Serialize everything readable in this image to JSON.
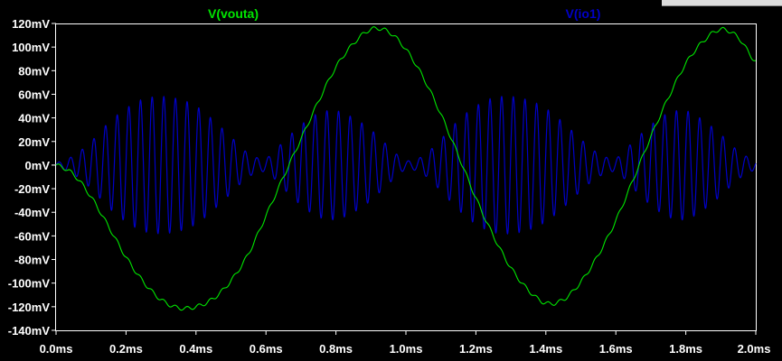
{
  "chart_data": {
    "type": "line",
    "title": "",
    "xlabel": "",
    "ylabel": "",
    "xlim": [
      0,
      2.0
    ],
    "ylim": [
      -140,
      120
    ],
    "x_unit": "ms",
    "y_unit": "mV",
    "grid": false,
    "legend_position": "top",
    "x_ticks": [
      "0.0ms",
      "0.2ms",
      "0.4ms",
      "0.6ms",
      "0.8ms",
      "1.0ms",
      "1.2ms",
      "1.4ms",
      "1.6ms",
      "1.8ms",
      "2.0ms"
    ],
    "y_ticks": [
      "120mV",
      "100mV",
      "80mV",
      "60mV",
      "40mV",
      "20mV",
      "0mV",
      "-20mV",
      "-40mV",
      "-60mV",
      "-80mV",
      "-100mV",
      "-120mV",
      "-140mV"
    ],
    "series": [
      {
        "name": "V(vouta)",
        "color": "#00e600",
        "x_ms": [
          0.0,
          0.05,
          0.1,
          0.15,
          0.2,
          0.25,
          0.3,
          0.35,
          0.4,
          0.45,
          0.5,
          0.55,
          0.6,
          0.65,
          0.7,
          0.75,
          0.8,
          0.85,
          0.9,
          0.95,
          1.0,
          1.05,
          1.1,
          1.15,
          1.2,
          1.25,
          1.3,
          1.35,
          1.4,
          1.45,
          1.5,
          1.55,
          1.6,
          1.65,
          1.7,
          1.75,
          1.8,
          1.85,
          1.9,
          1.95,
          2.0
        ],
        "values_mV": [
          0,
          -8,
          -27,
          -52,
          -78,
          -99,
          -114,
          -121,
          -120,
          -113,
          -98,
          -75,
          -43,
          -10,
          22,
          54,
          83,
          103,
          115,
          113,
          98,
          74,
          43,
          8,
          -28,
          -60,
          -87,
          -106,
          -117,
          -114,
          -99,
          -76,
          -47,
          -12,
          24,
          57,
          86,
          105,
          115,
          108,
          88
        ]
      },
      {
        "name": "V(io1)",
        "color": "#0000c8",
        "carrier_period_ms": 0.0333,
        "x_ms": [
          0.0,
          0.05,
          0.1,
          0.15,
          0.2,
          0.25,
          0.3,
          0.35,
          0.4,
          0.45,
          0.5,
          0.55,
          0.6,
          0.65,
          0.7,
          0.75,
          0.8,
          0.85,
          0.9,
          0.95,
          1.0,
          1.05,
          1.1,
          1.15,
          1.2,
          1.25,
          1.3,
          1.35,
          1.4,
          1.45,
          1.5,
          1.55,
          1.6,
          1.65,
          1.7,
          1.75,
          1.8,
          1.85,
          1.9,
          1.95,
          2.0
        ],
        "envelope_mV": [
          2,
          8,
          20,
          36,
          48,
          56,
          58,
          56,
          50,
          38,
          24,
          10,
          6,
          20,
          34,
          44,
          46,
          40,
          30,
          16,
          4,
          8,
          22,
          38,
          50,
          57,
          58,
          55,
          48,
          36,
          22,
          10,
          6,
          20,
          34,
          44,
          46,
          38,
          26,
          12,
          4
        ]
      }
    ]
  }
}
